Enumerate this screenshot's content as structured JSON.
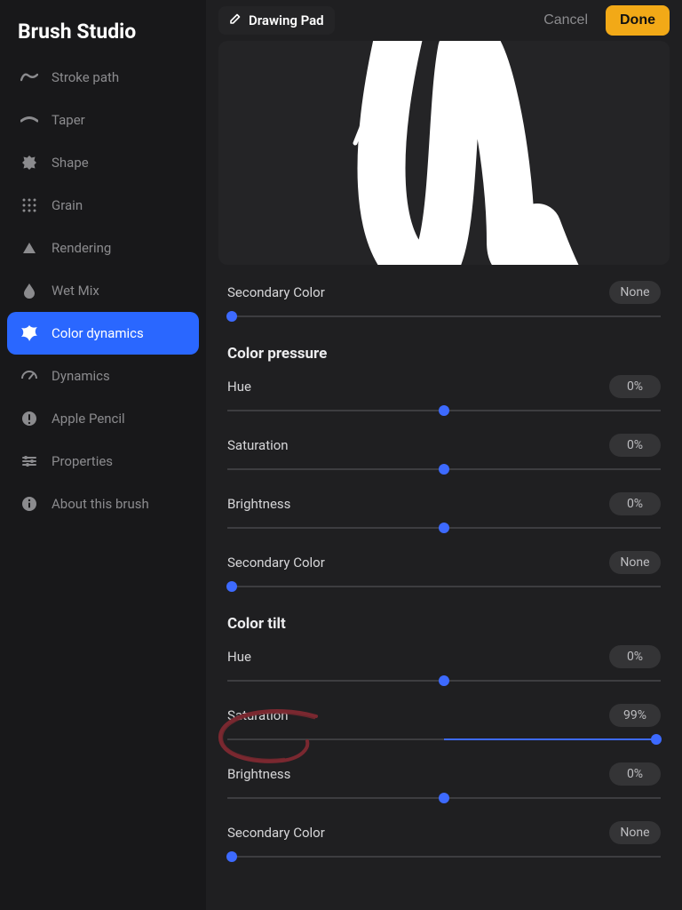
{
  "sidebar": {
    "title": "Brush Studio",
    "items": [
      {
        "id": "stroke-path",
        "label": "Stroke path"
      },
      {
        "id": "taper",
        "label": "Taper"
      },
      {
        "id": "shape",
        "label": "Shape"
      },
      {
        "id": "grain",
        "label": "Grain"
      },
      {
        "id": "rendering",
        "label": "Rendering"
      },
      {
        "id": "wet-mix",
        "label": "Wet Mix"
      },
      {
        "id": "color-dynamics",
        "label": "Color dynamics",
        "active": true
      },
      {
        "id": "dynamics",
        "label": "Dynamics"
      },
      {
        "id": "apple-pencil",
        "label": "Apple Pencil"
      },
      {
        "id": "properties",
        "label": "Properties"
      },
      {
        "id": "about",
        "label": "About this brush"
      }
    ]
  },
  "topbar": {
    "drawing_pad_label": "Drawing Pad",
    "cancel_label": "Cancel",
    "done_label": "Done"
  },
  "top_slider": {
    "secondary_color": {
      "label": "Secondary Color",
      "value": "None",
      "percent": 0,
      "min_origin": true
    }
  },
  "sections": {
    "color_pressure": {
      "heading": "Color pressure",
      "hue": {
        "label": "Hue",
        "value": "0%",
        "percent": 50
      },
      "saturation": {
        "label": "Saturation",
        "value": "0%",
        "percent": 50
      },
      "brightness": {
        "label": "Brightness",
        "value": "0%",
        "percent": 50
      },
      "secondary": {
        "label": "Secondary Color",
        "value": "None",
        "percent": 0,
        "min_origin": true
      }
    },
    "color_tilt": {
      "heading": "Color tilt",
      "hue": {
        "label": "Hue",
        "value": "0%",
        "percent": 50
      },
      "saturation": {
        "label": "Saturation",
        "value": "99%",
        "percent": 99,
        "fill_from_center": true,
        "annotated": true
      },
      "brightness": {
        "label": "Brightness",
        "value": "0%",
        "percent": 50
      },
      "secondary": {
        "label": "Secondary Color",
        "value": "None",
        "percent": 0,
        "min_origin": true
      }
    }
  },
  "colors": {
    "accent": "#2a67ff",
    "slider": "#3d6aff",
    "done": "#f2a917",
    "annotation": "#7a2830"
  }
}
